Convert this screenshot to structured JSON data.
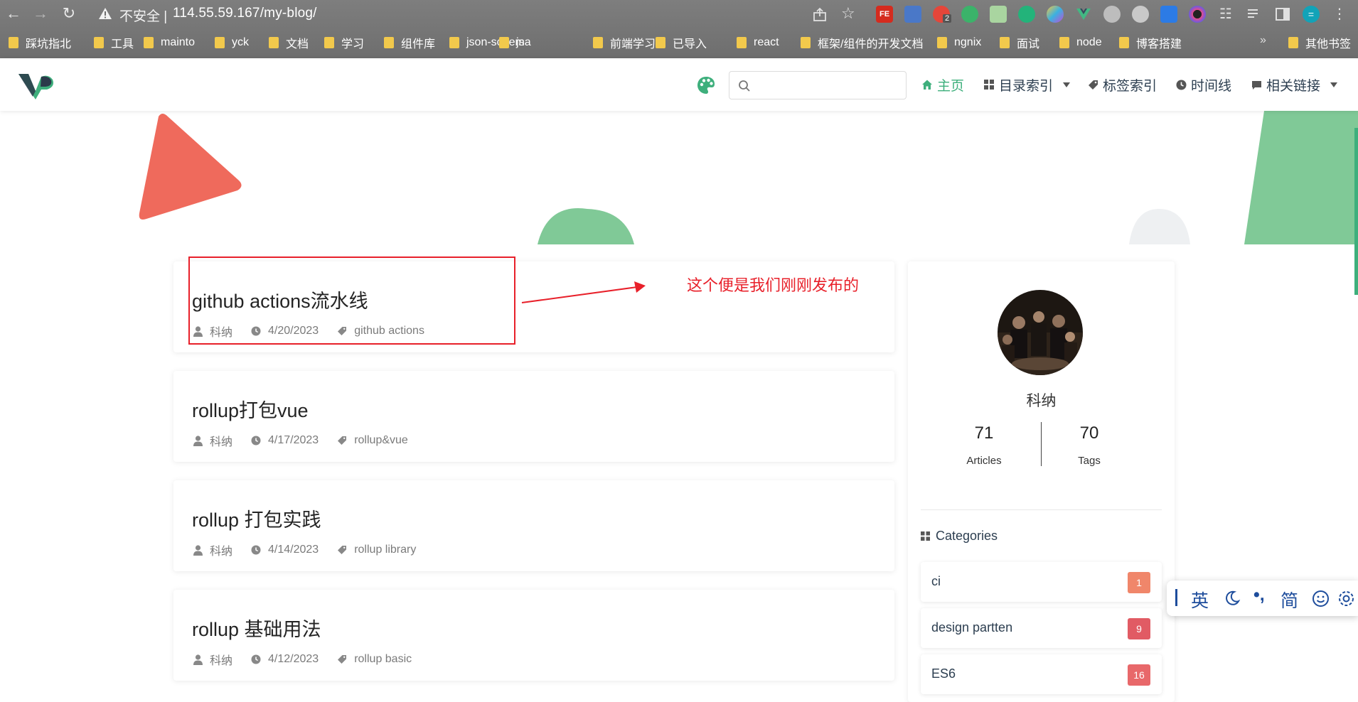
{
  "browser": {
    "security_label": "不安全 |",
    "url": "114.55.59.167/my-blog/",
    "ext_badge": "2",
    "ext_fe_label": "FE",
    "profile_initial": "=",
    "bookmarks": [
      "踩坑指北",
      "工具",
      "mainto",
      "yck",
      "文档",
      "学习",
      "组件库",
      "json-schema",
      "js",
      "前端学习",
      "已导入",
      "react",
      "框架/组件的开发文档",
      "ngnix",
      "面试",
      "node",
      "博客搭建"
    ],
    "bookmarks_overflow": "»",
    "other_bookmarks": "其他书签"
  },
  "nav": {
    "search_placeholder": "",
    "items": [
      {
        "label": "主页",
        "icon": "home-icon"
      },
      {
        "label": "目录索引",
        "icon": "grid-icon"
      },
      {
        "label": "标签索引",
        "icon": "tag-icon"
      },
      {
        "label": "时间线",
        "icon": "clock-icon"
      },
      {
        "label": "相关链接",
        "icon": "message-icon"
      }
    ]
  },
  "annotation": {
    "text": "这个便是我们刚刚发布的"
  },
  "posts": [
    {
      "title": "github actions流水线",
      "author": "科纳",
      "date": "4/20/2023",
      "tag": "github actions"
    },
    {
      "title": "rollup打包vue",
      "author": "科纳",
      "date": "4/17/2023",
      "tag": "rollup&vue"
    },
    {
      "title": "rollup 打包实践",
      "author": "科纳",
      "date": "4/14/2023",
      "tag": "rollup library"
    },
    {
      "title": "rollup 基础用法",
      "author": "科纳",
      "date": "4/12/2023",
      "tag": "rollup basic"
    }
  ],
  "sidebar": {
    "author": "科纳",
    "articles_count": "71",
    "articles_label": "Articles",
    "tags_count": "70",
    "tags_label": "Tags",
    "categories_heading": "Categories",
    "categories": [
      {
        "name": "ci",
        "count": "1",
        "color": "#f0866a"
      },
      {
        "name": "design partten",
        "count": "9",
        "color": "#e15b64"
      },
      {
        "name": "ES6",
        "count": "16",
        "color": "#e8686a"
      }
    ]
  },
  "ime": {
    "mode": "英",
    "simplified": "简"
  },
  "colors": {
    "accent": "#3eaf7c",
    "annotation": "#e8202a",
    "triangle": "#ef6a5c"
  }
}
